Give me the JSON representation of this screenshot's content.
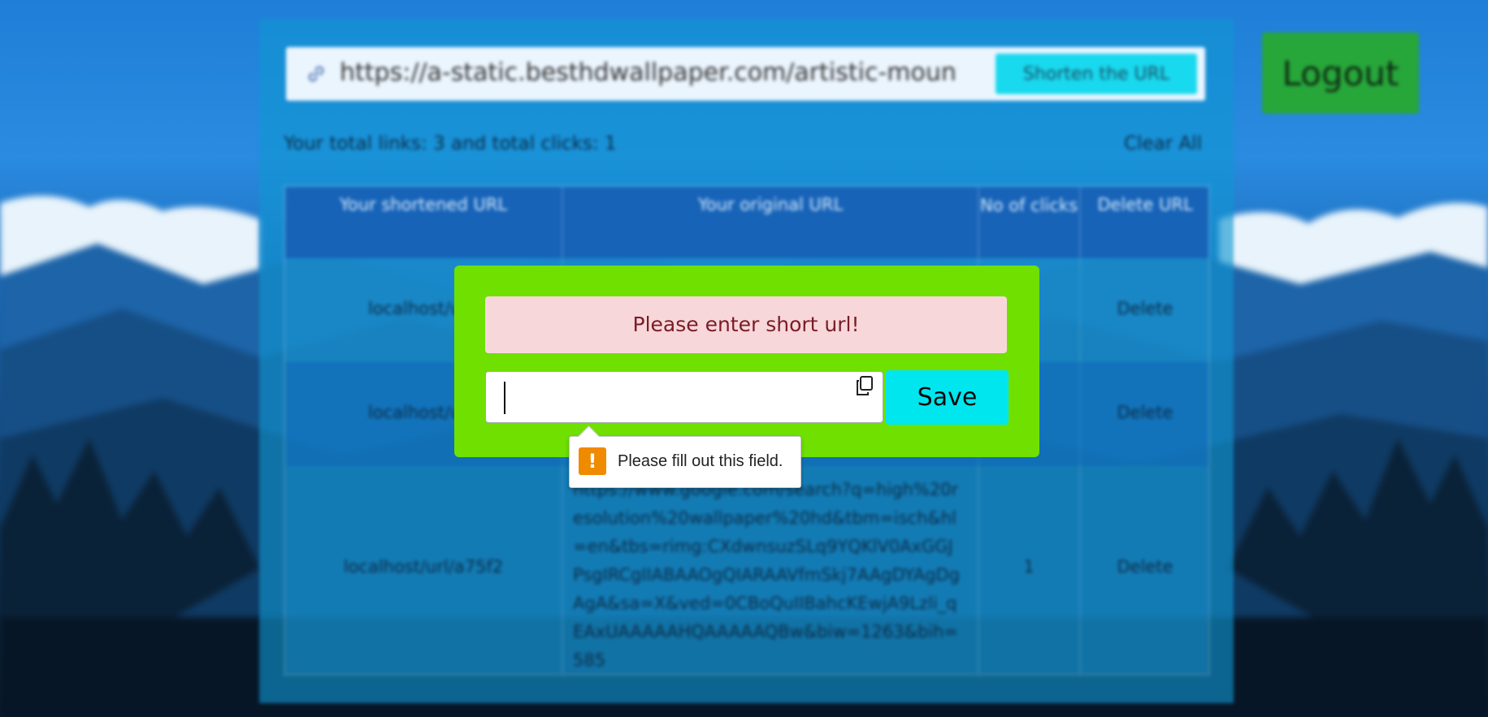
{
  "url_bar": {
    "value": "https://a-static.besthdwallpaper.com/artistic-mountains",
    "shorten_label": "Shorten the URL"
  },
  "logout_label": "Logout",
  "stats": {
    "text": "Your total links: 3 and total clicks: 1",
    "clear_all_label": "Clear All"
  },
  "table": {
    "headers": [
      "Your shortened URL",
      "Your original URL",
      "No of clicks",
      "Delete URL"
    ],
    "rows": [
      {
        "short": "localhost/url/",
        "original": "",
        "clicks": "",
        "delete": "Delete"
      },
      {
        "short": "localhost/url/",
        "original": "",
        "clicks": "",
        "delete": "Delete"
      },
      {
        "short": "localhost/url/a75f2",
        "original": "https://www.google.com/search?q=high%20resolution%20wallpaper%20hd&tbm=isch&hl=en&tbs=rimg:CXdwnsuzSLq9YQKlV0AxGGJPsgIRCgIIABAAOgQIARAAVfmSkj7AAgDYAgDgAgA&sa=X&ved=0CBoQuIIBahcKEwjA9Lzli_qEAxUAAAAAHQAAAAAQBw&biw=1263&bih=585",
        "clicks": "1",
        "delete": "Delete"
      }
    ]
  },
  "modal": {
    "alert_text": "Please enter short url!",
    "input_value": "",
    "save_label": "Save"
  },
  "tooltip": {
    "text": "Please fill out this field."
  },
  "colors": {
    "modal_bg": "#6fe000",
    "alert_bg": "#f7d7da",
    "save_bg": "#00e6ef",
    "logout_bg": "#27a63a",
    "warning": "#f08a00"
  }
}
